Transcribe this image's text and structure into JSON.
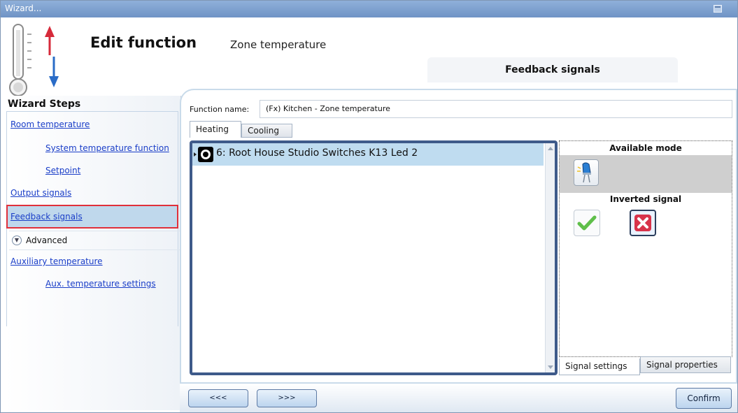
{
  "window": {
    "title": "Wizard..."
  },
  "header": {
    "title": "Edit function",
    "subtitle": "Zone temperature",
    "section_tab": "Feedback signals"
  },
  "sidebar": {
    "title": "Wizard Steps",
    "steps": [
      {
        "label": "Room temperature",
        "indent": 0,
        "selected": false
      },
      {
        "label": "System temperature function",
        "indent": 1,
        "selected": false
      },
      {
        "label": "Setpoint",
        "indent": 1,
        "selected": false
      },
      {
        "label": "Output signals",
        "indent": 0,
        "selected": false
      },
      {
        "label": "Feedback signals",
        "indent": 0,
        "selected": true
      },
      {
        "label": "Auxiliary temperature",
        "indent": 0,
        "selected": false
      },
      {
        "label": "Aux. temperature settings",
        "indent": 1,
        "selected": false
      }
    ],
    "advanced_label": "Advanced"
  },
  "main": {
    "function_name_label": "Function name:",
    "function_name_value": "(Fx) Kitchen - Zone temperature",
    "tabs": [
      "Heating",
      "Cooling"
    ],
    "active_tab": "Heating",
    "signals": [
      {
        "label": "6: Root House Studio Switches K13 Led 2"
      }
    ],
    "side_panel": {
      "available_mode_label": "Available mode",
      "inverted_signal_label": "Inverted signal",
      "sub_tabs": [
        "Signal settings",
        "Signal properties"
      ]
    }
  },
  "footer": {
    "prev_label": "<<<",
    "next_label": ">>>",
    "confirm_label": "Confirm"
  },
  "colors": {
    "selection_border": "#e0303a",
    "link": "#1a3ec8",
    "listbox_border": "#3e5a8a"
  }
}
